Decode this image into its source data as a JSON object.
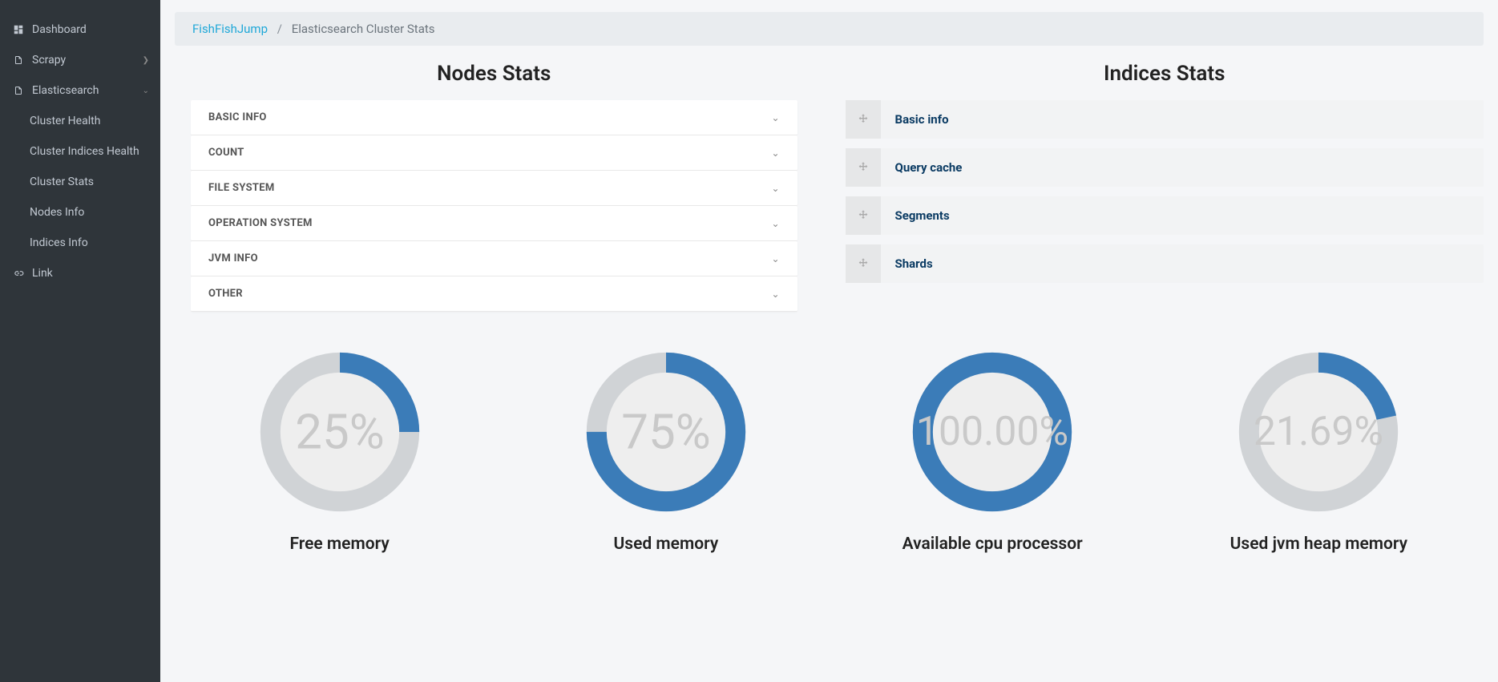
{
  "sidebar": {
    "items": [
      {
        "label": "Dashboard",
        "icon": "dashboard"
      },
      {
        "label": "Scrapy",
        "icon": "file",
        "chev": "right"
      },
      {
        "label": "Elasticsearch",
        "icon": "file",
        "chev": "down",
        "sub": [
          {
            "label": "Cluster Health"
          },
          {
            "label": "Cluster Indices Health"
          },
          {
            "label": "Cluster Stats"
          },
          {
            "label": "Nodes Info"
          },
          {
            "label": "Indices Info"
          }
        ]
      },
      {
        "label": "Link",
        "icon": "link"
      }
    ]
  },
  "breadcrumb": {
    "root": "FishFishJump",
    "current": "Elasticsearch Cluster Stats"
  },
  "nodes_stats": {
    "title": "Nodes Stats",
    "items": [
      {
        "label": "BASIC INFO"
      },
      {
        "label": "COUNT"
      },
      {
        "label": "FILE SYSTEM"
      },
      {
        "label": "OPERATION SYSTEM"
      },
      {
        "label": "JVM INFO"
      },
      {
        "label": "OTHER"
      }
    ]
  },
  "indices_stats": {
    "title": "Indices Stats",
    "items": [
      {
        "label": "Basic info"
      },
      {
        "label": "Query cache"
      },
      {
        "label": "Segments"
      },
      {
        "label": "Shards"
      }
    ]
  },
  "chart_data": [
    {
      "type": "pie",
      "title": "Free memory",
      "value": 25,
      "display": "25%",
      "unit": "%",
      "range": [
        0,
        100
      ]
    },
    {
      "type": "pie",
      "title": "Used memory",
      "value": 75,
      "display": "75%",
      "unit": "%",
      "range": [
        0,
        100
      ]
    },
    {
      "type": "pie",
      "title": "Available cpu processor",
      "value": 100.0,
      "display": "100.00%",
      "unit": "%",
      "range": [
        0,
        100
      ]
    },
    {
      "type": "pie",
      "title": "Used jvm heap memory",
      "value": 21.69,
      "display": "21.69%",
      "unit": "%",
      "range": [
        0,
        100
      ]
    }
  ],
  "colors": {
    "accent": "#3b7cb8",
    "ring_bg": "#d0d3d6",
    "sidebar_bg": "#2f353a",
    "link": "#20a8d8"
  }
}
